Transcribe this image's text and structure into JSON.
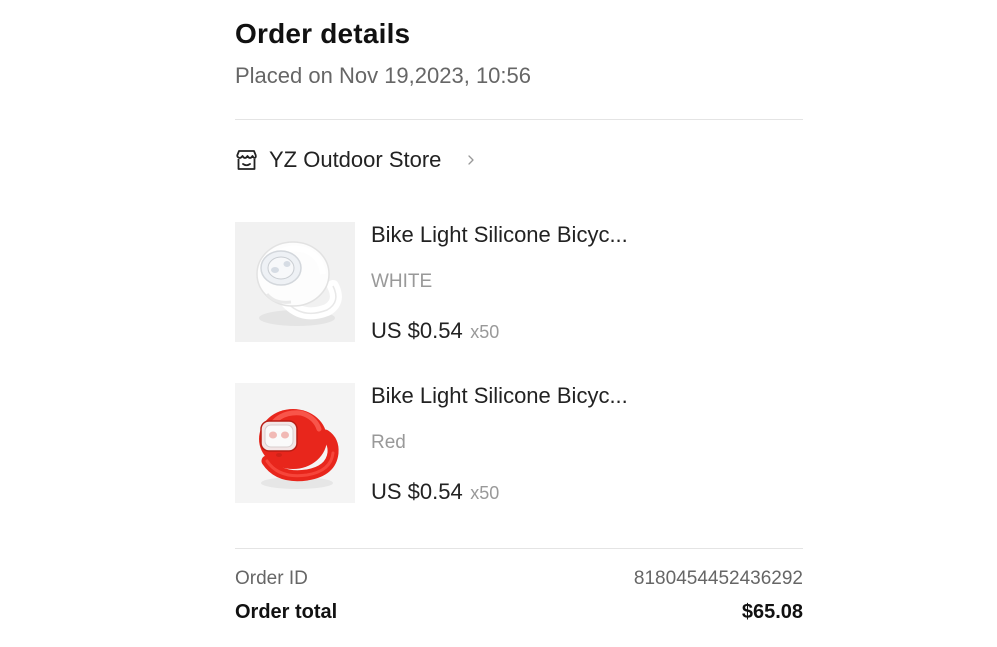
{
  "header": {
    "title": "Order details",
    "placed": "Placed on Nov 19,2023, 10:56"
  },
  "store": {
    "name": "YZ Outdoor Store",
    "icon": "store-icon",
    "chevron_icon": "chevron-right-icon"
  },
  "items": [
    {
      "name": "Bike Light Silicone Bicyc...",
      "variant": "WHITE",
      "price": "US $0.54",
      "qty": "x50",
      "image": "white-bike-light-image",
      "color": "#ffffff"
    },
    {
      "name": "Bike Light Silicone Bicyc...",
      "variant": "Red",
      "price": "US $0.54",
      "qty": "x50",
      "image": "red-bike-light-image",
      "color": "#e8261c"
    }
  ],
  "summary": {
    "order_id_label": "Order ID",
    "order_id_value": "8180454452436292",
    "total_label": "Order total",
    "total_value": "$65.08"
  }
}
